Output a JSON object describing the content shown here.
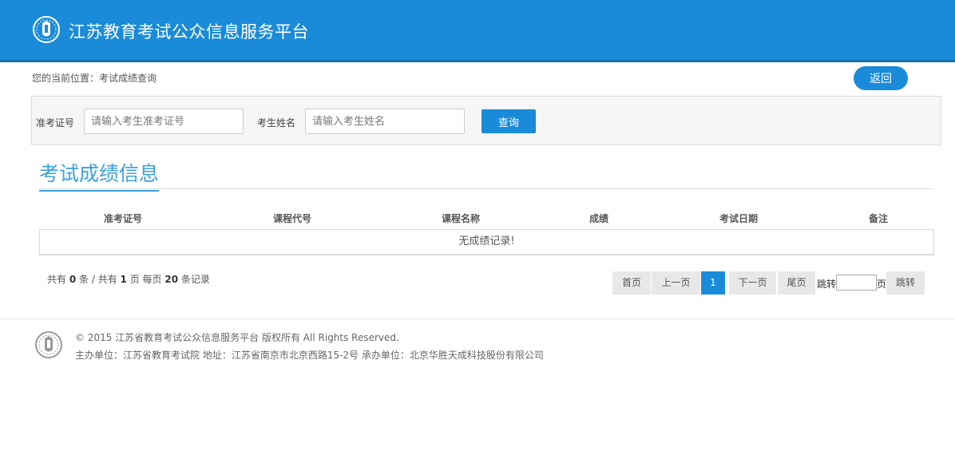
{
  "header": {
    "title": "江苏教育考试公众信息服务平台",
    "color": "#1a8bd8"
  },
  "breadcrumb": {
    "text": "您的当前位置：考试成绩查询"
  },
  "back_button": {
    "label": "返回"
  },
  "search": {
    "ticket_label": "准考证号",
    "ticket_placeholder": "请输入考生准考证号",
    "name_label": "考生姓名",
    "name_placeholder": "请输入考生姓名",
    "submit_label": "查询"
  },
  "section": {
    "title": "考试成绩信息"
  },
  "table": {
    "columns": [
      "准考证号",
      "课程代号",
      "课程名称",
      "成绩",
      "考试日期",
      "备注"
    ],
    "empty_text": "无成绩记录!"
  },
  "summary": {
    "prefix": "共有",
    "total": "0",
    "mid1": "条 / 共有",
    "pages": "1",
    "mid2": "页 每页",
    "per_page": "20",
    "suffix": "条记录"
  },
  "pagination": {
    "first": "首页",
    "prev": "上一页",
    "current": "1",
    "next": "下一页",
    "last": "尾页",
    "jump_label": "跳转",
    "page_unit": "页",
    "jump_button": "跳转"
  },
  "footer": {
    "copyright": "© 2015 江苏省教育考试公众信息服务平台 版权所有 All Rights Reserved.",
    "info": "主办单位：江苏省教育考试院 地址：江苏省南京市北京西路15-2号 承办单位：北京华胜天成科技股份有限公司"
  }
}
